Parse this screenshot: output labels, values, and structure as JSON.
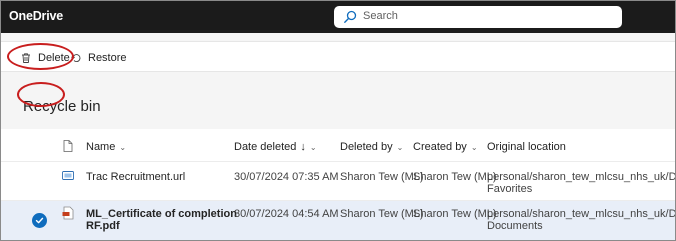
{
  "app": {
    "title": "OneDrive"
  },
  "search": {
    "placeholder": "Search"
  },
  "commands": {
    "delete_label": "Delete",
    "restore_label": "Restore"
  },
  "page": {
    "title": "Recycle bin"
  },
  "columns": {
    "name": "Name",
    "date_deleted": "Date deleted",
    "date_deleted_sort": "↓",
    "deleted_by": "Deleted by",
    "created_by": "Created by",
    "original_location": "Original location"
  },
  "rows": [
    {
      "name": "Trac Recruitment.url",
      "date_deleted": "30/07/2024 07:35 AM",
      "deleted_by": "Sharon Tew (ML)",
      "created_by": "Sharon Tew (ML)",
      "location_line1": "personal/sharon_tew_mlcsu_nhs_uk/Documents/",
      "location_line2": "Favorites",
      "selected": false
    },
    {
      "name_line1": "ML_Certificate of completion",
      "name_line2": "RF.pdf",
      "date_deleted": "30/07/2024 04:54 AM",
      "deleted_by": "Sharon Tew (ML)",
      "created_by": "Sharon Tew (ML)",
      "location_line1": "personal/sharon_tew_mlcsu_nhs_uk/Documents/",
      "location_line2": "Documents",
      "selected": true
    }
  ],
  "colors": {
    "topbar": "#1b1b1b",
    "accent": "#0f6cbd",
    "annotation": "#c81e1e",
    "selected_row": "#e8eef8"
  }
}
